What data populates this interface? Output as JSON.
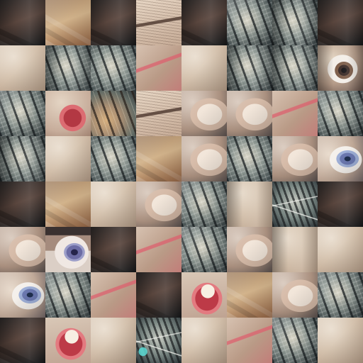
{
  "puzzle": {
    "grid": {
      "rows": 8,
      "columns": 8
    },
    "tiles": [
      [
        "dark-hair",
        "hair-ear",
        "dark-hair",
        "eyebrow",
        "dark-hair",
        "cat-fur",
        "cat-eye-closed",
        "dark-hair"
      ],
      [
        "skin",
        "cat-dark",
        "cat-stripes",
        "red-lip-skin",
        "skin",
        "cat-dark",
        "cat-dark",
        "brown-eye"
      ],
      [
        "cat-fur",
        "lip-fur",
        "cat-eye-amber",
        "eyebrow",
        "finger",
        "finger",
        "nose",
        "cat-fur"
      ],
      [
        "cat-dark",
        "skin",
        "cat-stripes",
        "hair-skin",
        "finger",
        "cat-stripes",
        "finger",
        "blue-eye"
      ],
      [
        "dark-hair",
        "hair",
        "skin",
        "finger",
        "cat-fur",
        "skin-shadow",
        "whisker",
        "dark-hair"
      ],
      [
        "finger",
        "purple-eye",
        "dark-hair",
        "skin-red",
        "cat-nose",
        "finger",
        "skin-shadow",
        "skin"
      ],
      [
        "blue-eye",
        "cat-fur",
        "skin-red",
        "dark-hair",
        "teeth-lip",
        "hair",
        "finger",
        "cat-face"
      ],
      [
        "dark-hair",
        "smile",
        "skin",
        "cat-eye-green",
        "skin",
        "skin-red",
        "cat-fur",
        "skin"
      ]
    ]
  }
}
